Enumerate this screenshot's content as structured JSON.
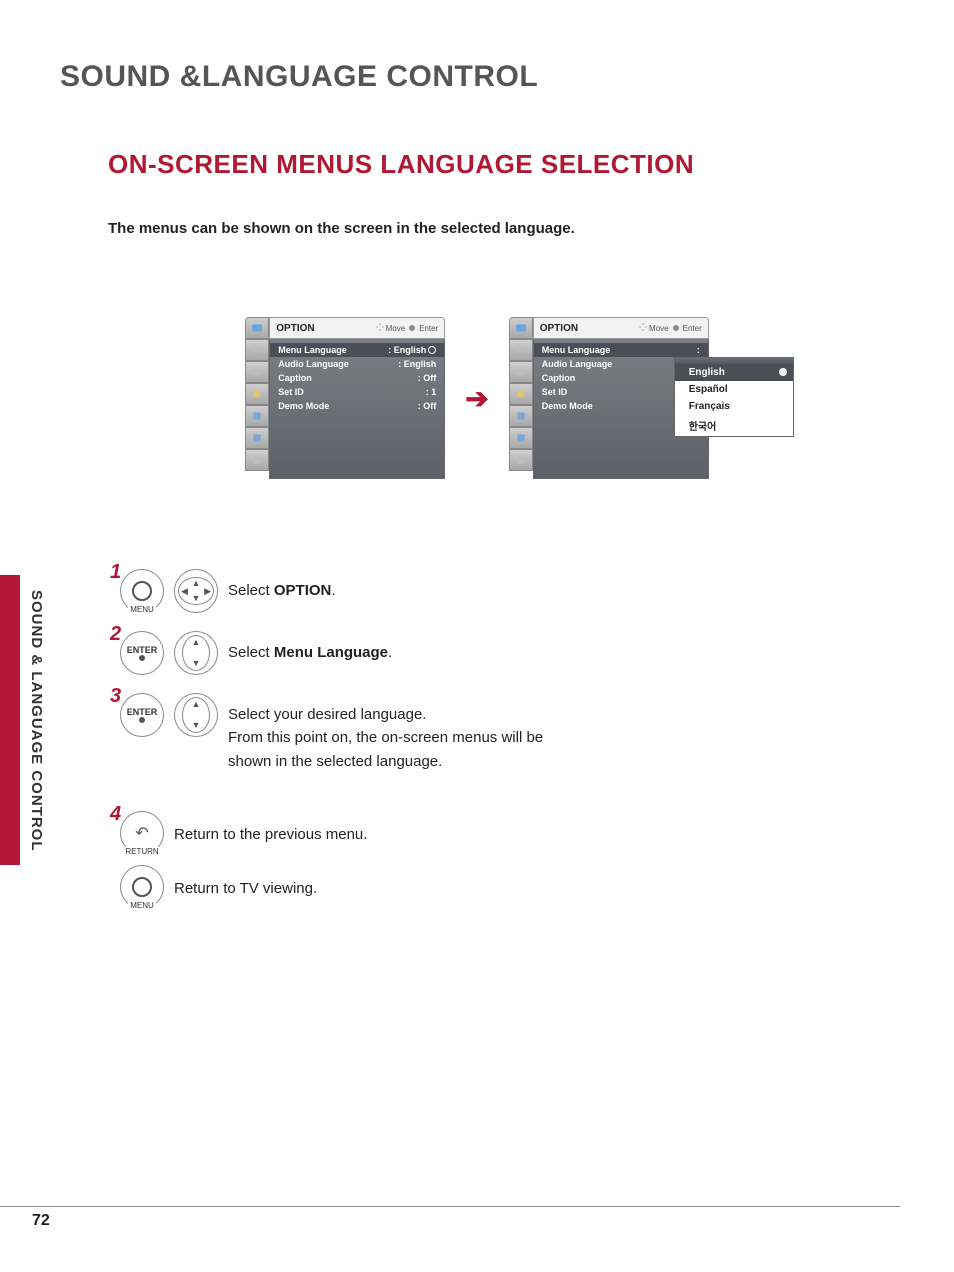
{
  "page_number": "72",
  "section_title": "SOUND &LANGUAGE CONTROL",
  "subsection_title": "ON-SCREEN MENUS LANGUAGE SELECTION",
  "intro_text": "The menus can be shown on the screen in the selected language.",
  "spine_text": "SOUND & LANGUAGE CONTROL",
  "osd": {
    "header_title": "OPTION",
    "move_label": "Move",
    "enter_label": "Enter",
    "items": [
      {
        "label": "Menu Language",
        "value": ": English",
        "selected": true,
        "radio": true
      },
      {
        "label": "Audio Language",
        "value": ": English",
        "selected": false,
        "radio": false
      },
      {
        "label": "Caption",
        "value": ": Off",
        "selected": false,
        "radio": false
      },
      {
        "label": "Set ID",
        "value": ": 1",
        "selected": false,
        "radio": false
      },
      {
        "label": "Demo Mode",
        "value": ": Off",
        "selected": false,
        "radio": false
      }
    ]
  },
  "osd2_popup": {
    "options": [
      {
        "label": "English",
        "selected": true
      },
      {
        "label": "Español",
        "selected": false
      },
      {
        "label": "Français",
        "selected": false
      },
      {
        "label": "한국어",
        "selected": false
      }
    ]
  },
  "steps": {
    "s1": {
      "num": "1",
      "btn_label": "MENU",
      "text_prefix": "Select ",
      "bold": "OPTION",
      "suffix": "."
    },
    "s2": {
      "num": "2",
      "btn_label": "ENTER",
      "text_prefix": "Select ",
      "bold": "Menu Language",
      "suffix": "."
    },
    "s3": {
      "num": "3",
      "btn_label": "ENTER",
      "line1": "Select your desired language.",
      "line2": "From this point on, the on-screen menus will be shown in the selected language."
    },
    "s4": {
      "num": "4",
      "btn_label": "RETURN",
      "text": "Return to the previous menu."
    },
    "s5": {
      "btn_label": "MENU",
      "text": "Return to TV viewing."
    }
  }
}
